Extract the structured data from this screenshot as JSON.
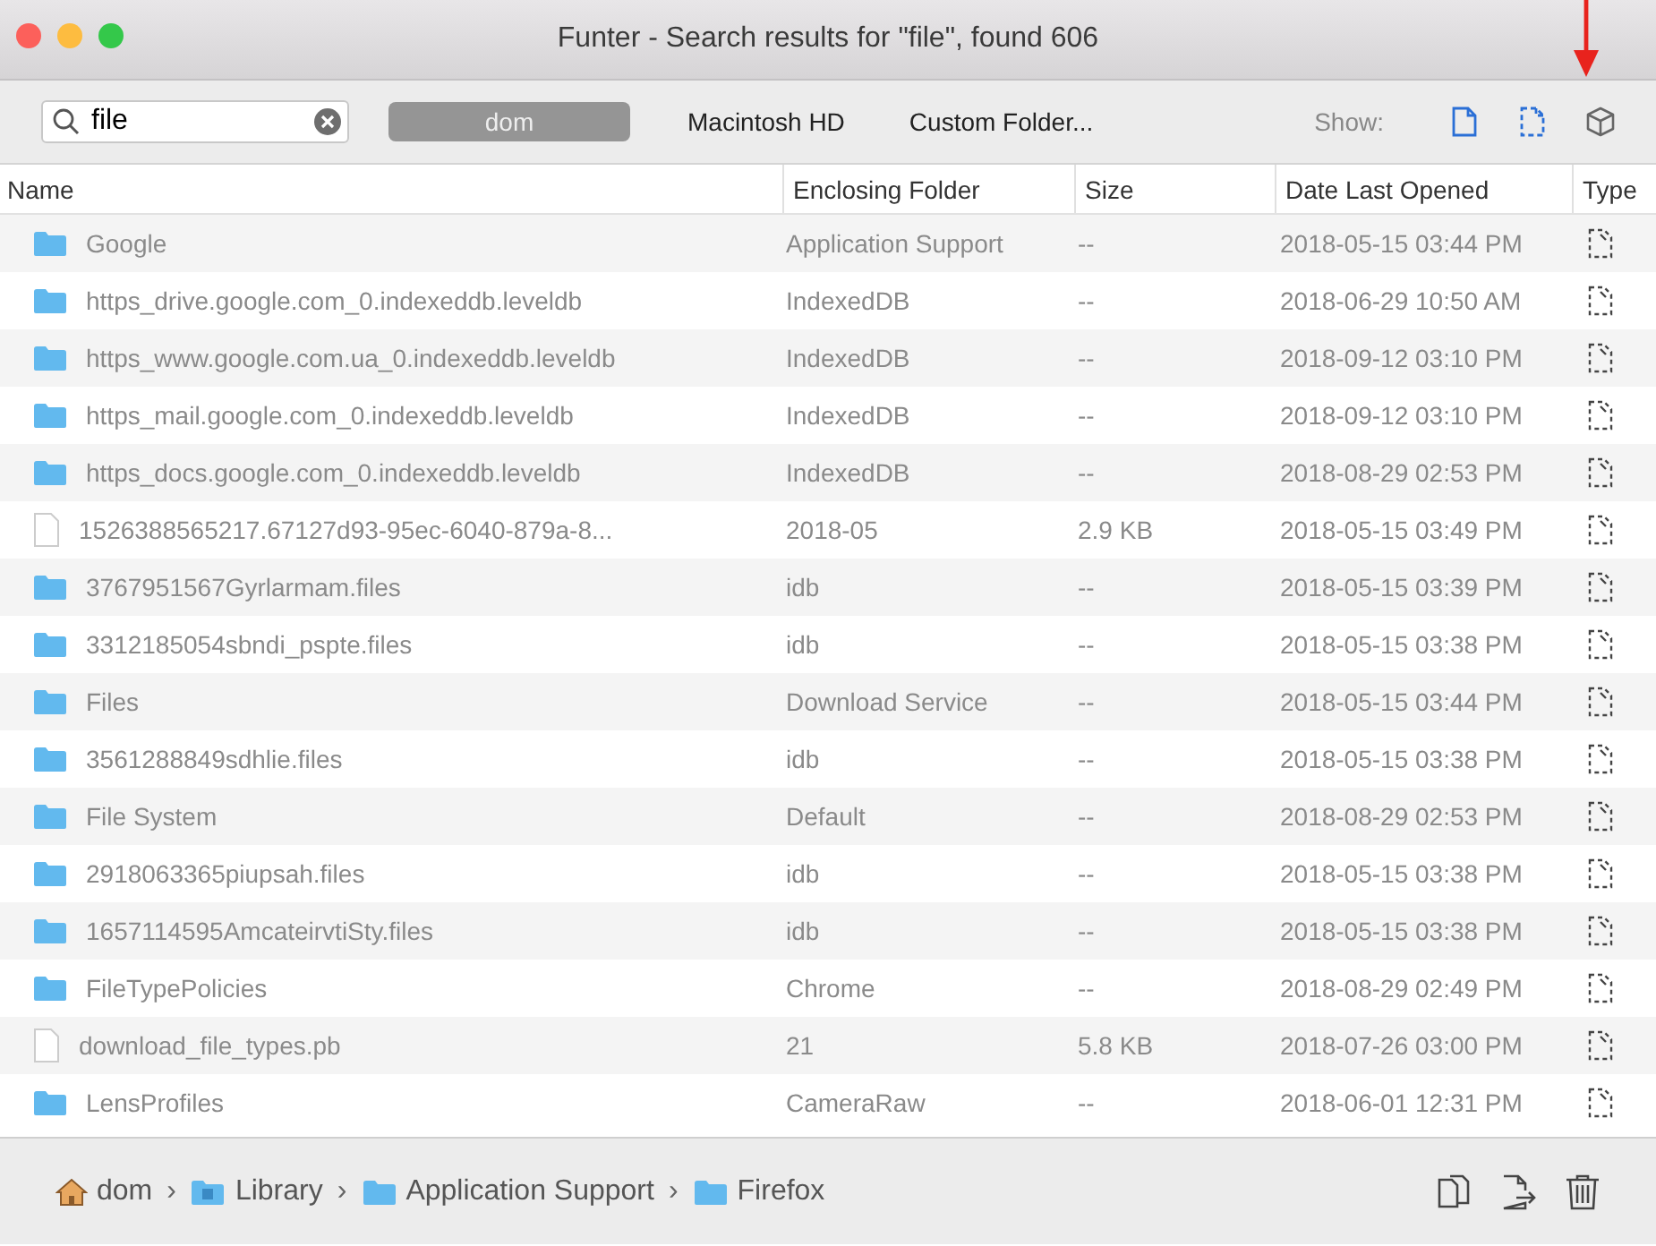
{
  "window": {
    "title": "Funter - Search results for \"file\", found 606"
  },
  "toolbar": {
    "search": {
      "value": "file"
    },
    "scopes": [
      {
        "label": "dom",
        "selected": true
      },
      {
        "label": "Macintosh HD",
        "selected": false
      },
      {
        "label": "Custom Folder...",
        "selected": false
      }
    ],
    "show_label": "Show:",
    "show_toggles": [
      {
        "kind": "file",
        "on": true
      },
      {
        "kind": "hidden",
        "on": true
      },
      {
        "kind": "package",
        "on": false
      }
    ]
  },
  "table": {
    "columns": [
      "Name",
      "Enclosing Folder",
      "Size",
      "Date Last Opened",
      "Type"
    ],
    "rows": [
      {
        "kind": "folder",
        "name": "Google",
        "folder": "Application Support",
        "size": "--",
        "date": "2018-05-15 03:44 PM"
      },
      {
        "kind": "folder",
        "name": "https_drive.google.com_0.indexeddb.leveldb",
        "folder": "IndexedDB",
        "size": "--",
        "date": "2018-06-29 10:50 AM"
      },
      {
        "kind": "folder",
        "name": "https_www.google.com.ua_0.indexeddb.leveldb",
        "folder": "IndexedDB",
        "size": "--",
        "date": "2018-09-12 03:10 PM"
      },
      {
        "kind": "folder",
        "name": "https_mail.google.com_0.indexeddb.leveldb",
        "folder": "IndexedDB",
        "size": "--",
        "date": "2018-09-12 03:10 PM"
      },
      {
        "kind": "folder",
        "name": "https_docs.google.com_0.indexeddb.leveldb",
        "folder": "IndexedDB",
        "size": "--",
        "date": "2018-08-29 02:53 PM"
      },
      {
        "kind": "file",
        "name": "1526388565217.67127d93-95ec-6040-879a-8...",
        "folder": "2018-05",
        "size": "2.9 KB",
        "date": "2018-05-15 03:49 PM"
      },
      {
        "kind": "folder",
        "name": "3767951567Gyrlarmam.files",
        "folder": "idb",
        "size": "--",
        "date": "2018-05-15 03:39 PM"
      },
      {
        "kind": "folder",
        "name": "3312185054sbndi_pspte.files",
        "folder": "idb",
        "size": "--",
        "date": "2018-05-15 03:38 PM"
      },
      {
        "kind": "folder",
        "name": "Files",
        "folder": "Download Service",
        "size": "--",
        "date": "2018-05-15 03:44 PM"
      },
      {
        "kind": "folder",
        "name": "3561288849sdhlie.files",
        "folder": "idb",
        "size": "--",
        "date": "2018-05-15 03:38 PM"
      },
      {
        "kind": "folder",
        "name": "File System",
        "folder": "Default",
        "size": "--",
        "date": "2018-08-29 02:53 PM"
      },
      {
        "kind": "folder",
        "name": "2918063365piupsah.files",
        "folder": "idb",
        "size": "--",
        "date": "2018-05-15 03:38 PM"
      },
      {
        "kind": "folder",
        "name": "1657114595AmcateirvtiSty.files",
        "folder": "idb",
        "size": "--",
        "date": "2018-05-15 03:38 PM"
      },
      {
        "kind": "folder",
        "name": "FileTypePolicies",
        "folder": "Chrome",
        "size": "--",
        "date": "2018-08-29 02:49 PM"
      },
      {
        "kind": "file",
        "name": "download_file_types.pb",
        "folder": "21",
        "size": "5.8 KB",
        "date": "2018-07-26 03:00 PM"
      },
      {
        "kind": "folder",
        "name": "LensProfiles",
        "folder": "CameraRaw",
        "size": "--",
        "date": "2018-06-01 12:31 PM"
      }
    ]
  },
  "path_bar": {
    "crumbs": [
      {
        "kind": "home",
        "label": "dom"
      },
      {
        "kind": "library",
        "label": "Library"
      },
      {
        "kind": "folder",
        "label": "Application Support"
      },
      {
        "kind": "folder",
        "label": "Firefox"
      }
    ],
    "separator": "›"
  }
}
